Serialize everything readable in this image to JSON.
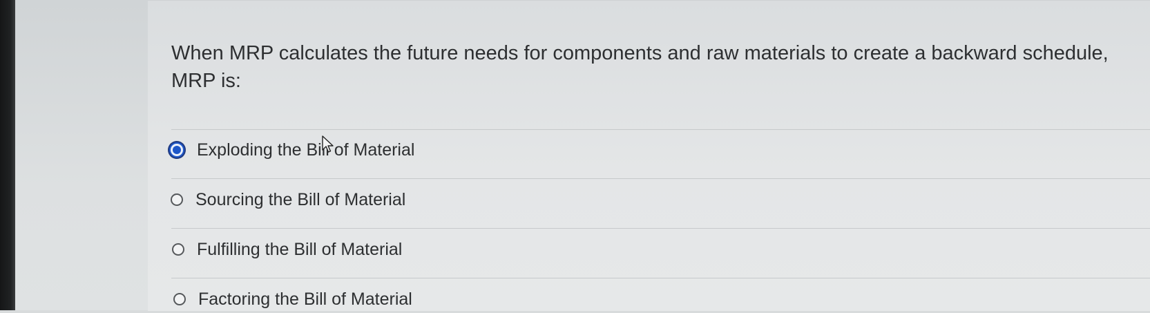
{
  "question": {
    "text": "When MRP calculates the future needs for components and raw materials to create a backward schedule, MRP is:"
  },
  "options": [
    {
      "label": "Exploding the Bill of Material",
      "selected": true
    },
    {
      "label": "Sourcing the Bill of Material",
      "selected": false
    },
    {
      "label": "Fulfilling the Bill of Material",
      "selected": false
    },
    {
      "label": "Factoring the Bill of Material",
      "selected": false
    }
  ],
  "icons": {
    "cursor": "arrow-cursor-icon"
  },
  "colors": {
    "selected_radio": "#1d56c8",
    "text": "#2d2f31"
  }
}
